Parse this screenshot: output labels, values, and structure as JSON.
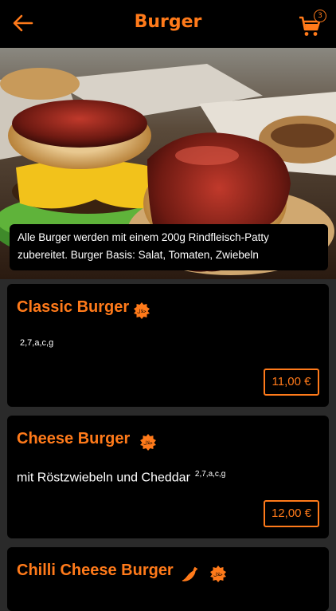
{
  "header": {
    "title": "Burger",
    "cart_count": "3",
    "accent_color": "#ff7a1a"
  },
  "hero": {
    "image_subject": "burger-photo",
    "caption": "Alle Burger werden mit einem 200g Rindfleisch-Patty zubereitet. Burger Basis: Salat, Tomaten, Zwiebeln"
  },
  "items": [
    {
      "name": "Classic Burger",
      "badges": [
        "halal-icon"
      ],
      "description": "",
      "allergens": "2,7,a,c,g",
      "price": "11,00 €"
    },
    {
      "name": "Cheese Burger",
      "badges": [
        "halal-icon"
      ],
      "description": "mit Röstzwiebeln und Cheddar",
      "allergens": "2,7,a,c,g",
      "price": "12,00 €"
    },
    {
      "name": "Chilli Cheese Burger",
      "badges": [
        "chili-icon",
        "halal-icon"
      ],
      "description": "",
      "allergens": "",
      "price": ""
    }
  ]
}
